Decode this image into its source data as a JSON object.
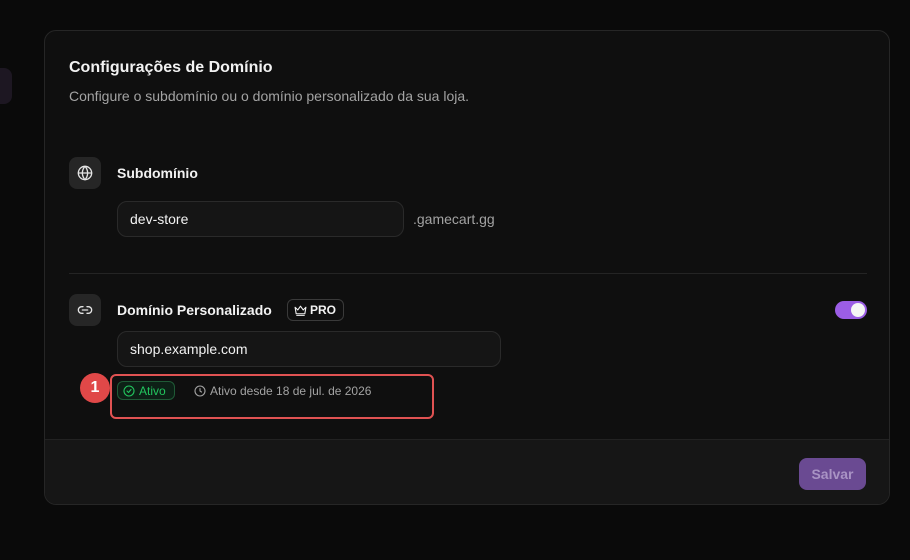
{
  "card": {
    "title": "Configurações de Domínio",
    "subtitle": "Configure o subdomínio ou o domínio personalizado da sua loja."
  },
  "subdomain": {
    "icon": "globe-icon",
    "label": "Subdomínio",
    "value": "dev-store",
    "suffix": ".gamecart.gg"
  },
  "custom_domain": {
    "icon": "link-icon",
    "label": "Domínio Personalizado",
    "badge": {
      "icon": "crown-icon",
      "label": "PRO"
    },
    "toggle_on": true,
    "value": "shop.example.com",
    "status": {
      "icon": "check-circle-icon",
      "label": "Ativo",
      "color": "#22c55e"
    },
    "since": {
      "icon": "clock-icon",
      "text": "Ativo desde 18 de jul. de 2026"
    }
  },
  "footer": {
    "save_label": "Salvar"
  },
  "annotation": {
    "number": "1",
    "color": "#e05252"
  },
  "colors": {
    "accent": "#9b5de5",
    "background": "#0a0a0a",
    "card": "#0f0f0f"
  }
}
